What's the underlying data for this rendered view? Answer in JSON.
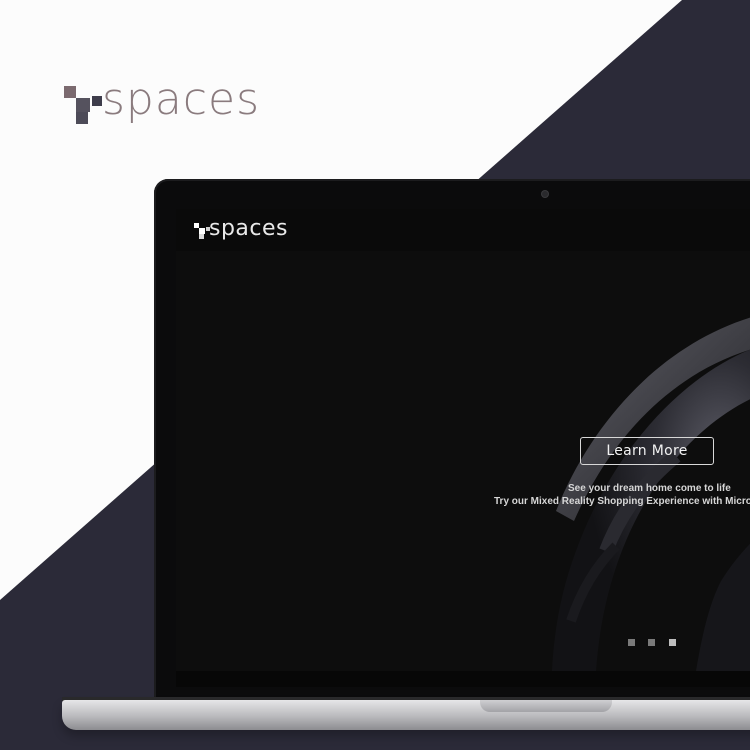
{
  "brand": {
    "name": "spaces"
  },
  "site": {
    "logo_text": "spaces",
    "hero": {
      "button_label": "Learn More",
      "tagline_line1": "See your dream home come to life",
      "tagline_line2": "Try our Mixed Reality Shopping Experience with Microso"
    },
    "slider": {
      "count": 3,
      "active_index": 2
    }
  },
  "colors": {
    "dark_band": "#2b2a38",
    "brand_text": "#8a7b7e",
    "screen_bg": "#070707"
  }
}
